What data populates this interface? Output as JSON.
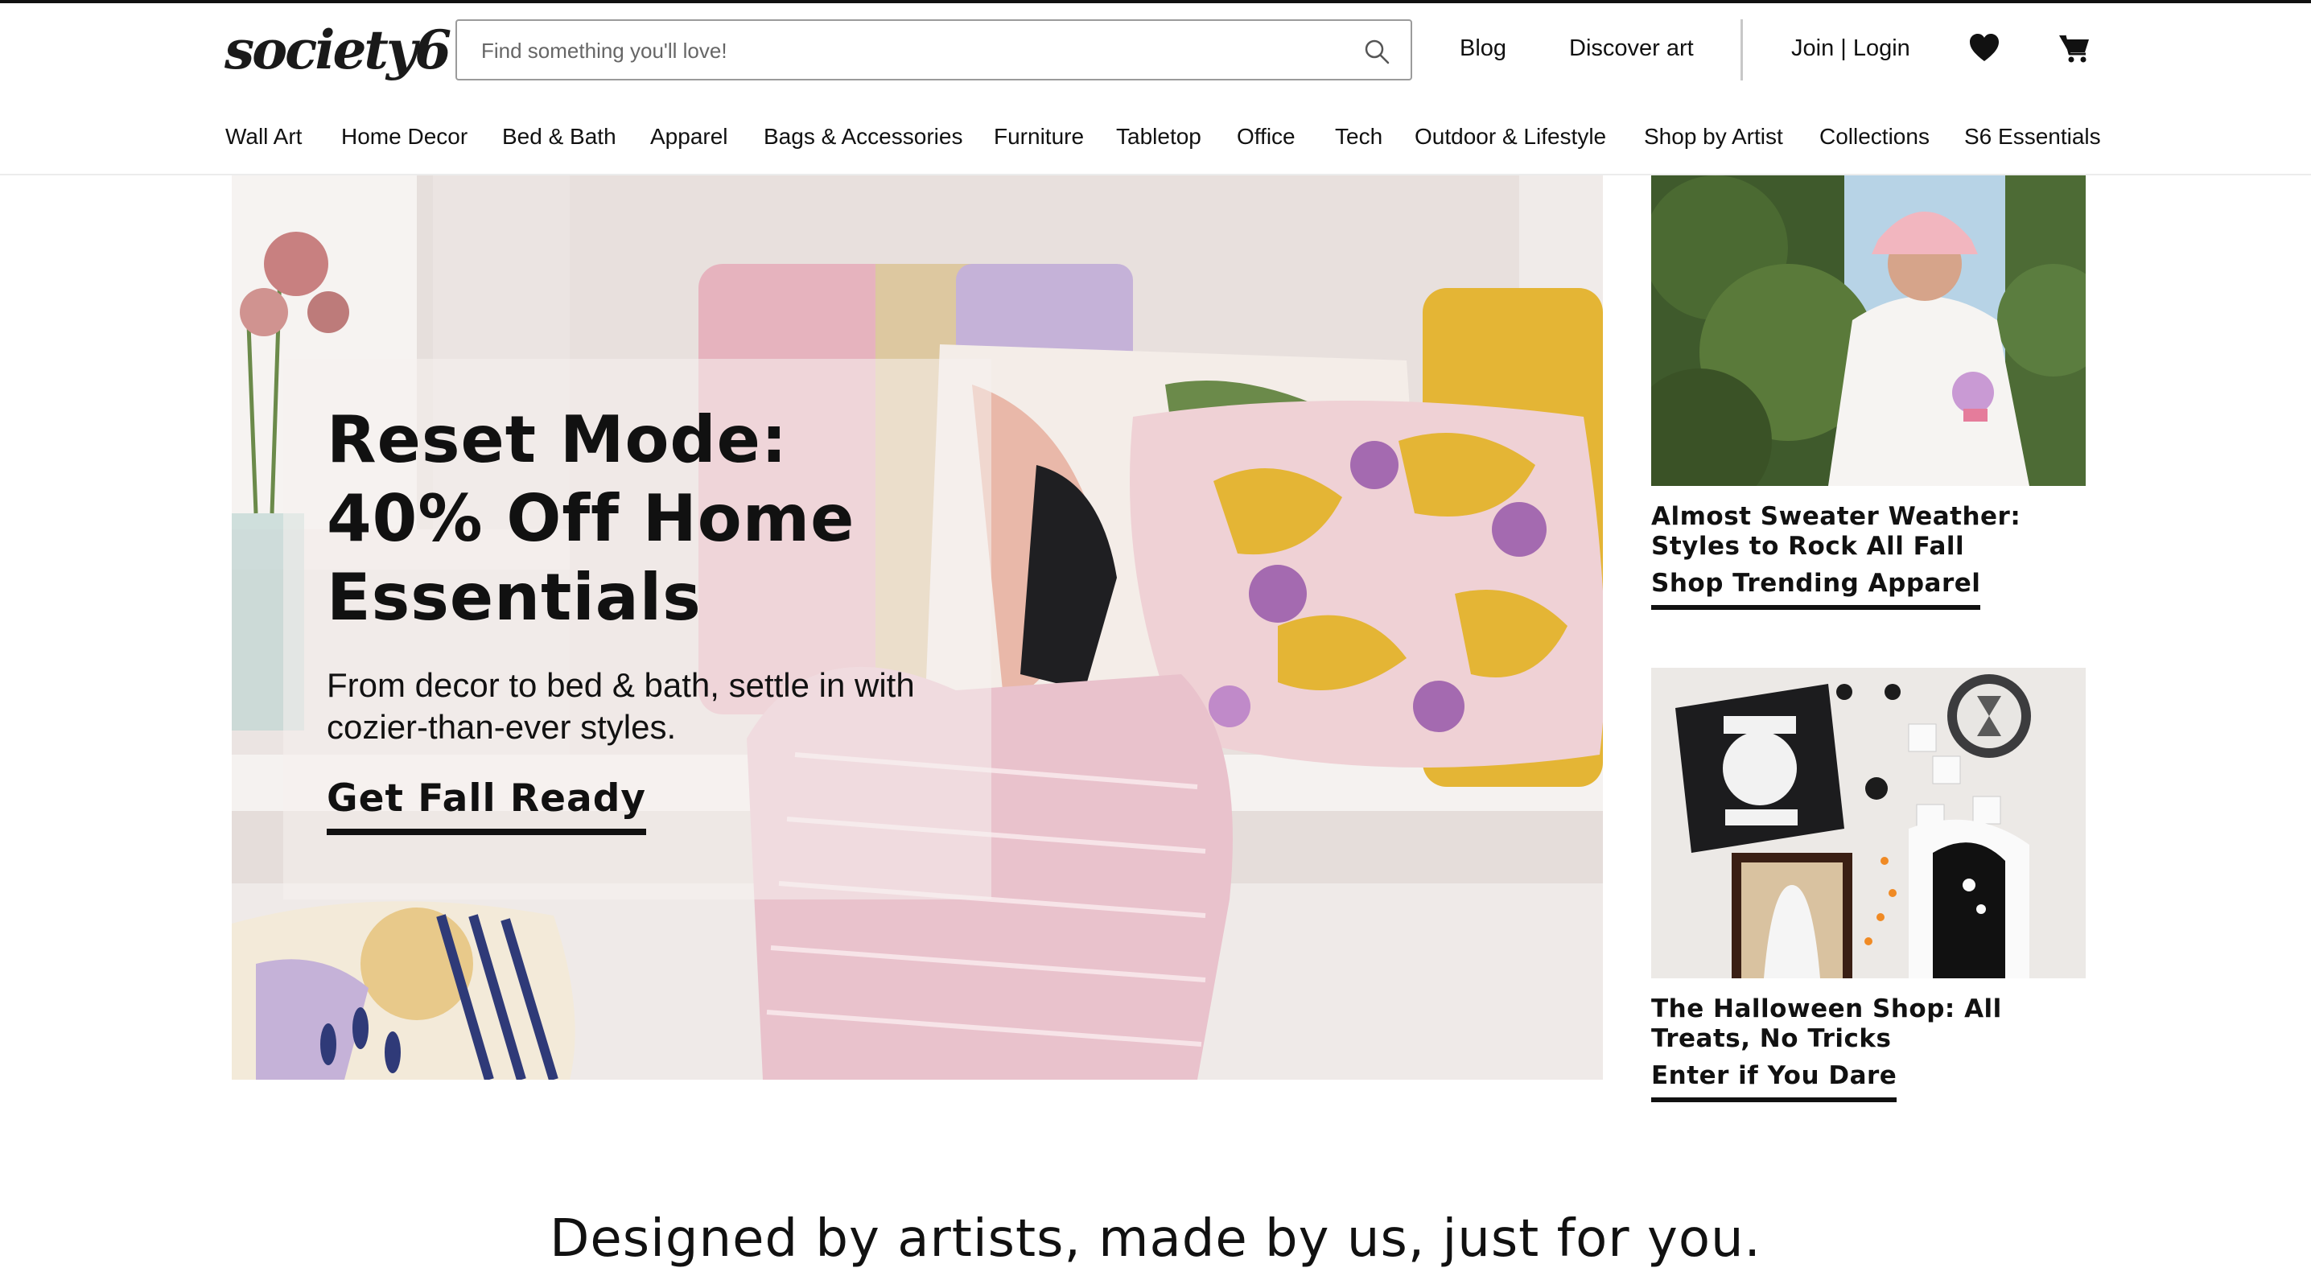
{
  "header": {
    "logo_text": "society6",
    "search_placeholder": "Find something you'll love!",
    "links": {
      "blog": "Blog",
      "discover_art": "Discover art",
      "join_login": "Join | Login"
    },
    "icons": {
      "search": "search-icon",
      "heart": "heart-icon",
      "cart": "cart-icon"
    }
  },
  "nav": {
    "items": [
      "Wall Art",
      "Home Decor",
      "Bed & Bath",
      "Apparel",
      "Bags & Accessories",
      "Furniture",
      "Tabletop",
      "Office",
      "Tech",
      "Outdoor & Lifestyle",
      "Shop by Artist",
      "Collections",
      "S6 Essentials"
    ]
  },
  "hero": {
    "title": "Reset Mode: 40% Off Home Essentials",
    "subtitle": "From decor to bed & bath, settle in with cozier-than-ever styles.",
    "cta": "Get Fall Ready"
  },
  "promos": [
    {
      "title": "Almost Sweater Weather: Styles to Rock All Fall",
      "link": "Shop Trending Apparel"
    },
    {
      "title": "The Halloween Shop: All Treats, No Tricks",
      "link": "Enter if You Dare"
    }
  ],
  "tagline": "Designed by artists, made by us, just for you.",
  "colors": {
    "text": "#111111",
    "border": "#9b9b9b",
    "accent_pink": "#e9b5c4",
    "accent_yellow": "#e4b535",
    "accent_purple": "#a46ab0"
  }
}
